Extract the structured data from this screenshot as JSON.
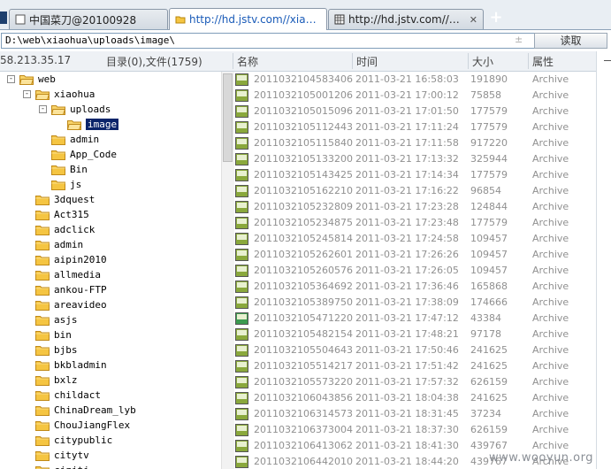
{
  "tabs": [
    {
      "label": "中国菜刀@20100928",
      "active": false
    },
    {
      "label": "http://hd.jstv.com//xiaohua/...",
      "active": true
    },
    {
      "label": "http://hd.jstv.com//xiaohua/...",
      "active": false
    }
  ],
  "new_tab_label": "+",
  "path_bar": {
    "path": "D:\\web\\xiaohua\\uploads\\image\\",
    "dropdown": "±",
    "read_button": "读取"
  },
  "header": {
    "ip": "58.213.35.17",
    "summary": "目录(0),文件(1759)",
    "col_name": "名称",
    "col_time": "时间",
    "col_size": "大小",
    "col_attr": "属性"
  },
  "tree": [
    {
      "label": "web",
      "level": 0,
      "expander": "-",
      "selected": false
    },
    {
      "label": "xiaohua",
      "level": 1,
      "expander": "-",
      "selected": false
    },
    {
      "label": "uploads",
      "level": 2,
      "expander": "-",
      "selected": false
    },
    {
      "label": "image",
      "level": 3,
      "expander": "",
      "selected": true
    },
    {
      "label": "admin",
      "level": 2,
      "expander": "",
      "selected": false
    },
    {
      "label": "App_Code",
      "level": 2,
      "expander": "",
      "selected": false
    },
    {
      "label": "Bin",
      "level": 2,
      "expander": "",
      "selected": false
    },
    {
      "label": "js",
      "level": 2,
      "expander": "",
      "selected": false
    },
    {
      "label": "3dquest",
      "level": 1,
      "expander": "",
      "selected": false
    },
    {
      "label": "Act315",
      "level": 1,
      "expander": "",
      "selected": false
    },
    {
      "label": "adclick",
      "level": 1,
      "expander": "",
      "selected": false
    },
    {
      "label": "admin",
      "level": 1,
      "expander": "",
      "selected": false
    },
    {
      "label": "aipin2010",
      "level": 1,
      "expander": "",
      "selected": false
    },
    {
      "label": "allmedia",
      "level": 1,
      "expander": "",
      "selected": false
    },
    {
      "label": "ankou-FTP",
      "level": 1,
      "expander": "",
      "selected": false
    },
    {
      "label": "areavideo",
      "level": 1,
      "expander": "",
      "selected": false
    },
    {
      "label": "asjs",
      "level": 1,
      "expander": "",
      "selected": false
    },
    {
      "label": "bin",
      "level": 1,
      "expander": "",
      "selected": false
    },
    {
      "label": "bjbs",
      "level": 1,
      "expander": "",
      "selected": false
    },
    {
      "label": "bkbladmin",
      "level": 1,
      "expander": "",
      "selected": false
    },
    {
      "label": "bxlz",
      "level": 1,
      "expander": "",
      "selected": false
    },
    {
      "label": "childact",
      "level": 1,
      "expander": "",
      "selected": false
    },
    {
      "label": "ChinaDream_lyb",
      "level": 1,
      "expander": "",
      "selected": false
    },
    {
      "label": "ChouJiangFlex",
      "level": 1,
      "expander": "",
      "selected": false
    },
    {
      "label": "citypublic",
      "level": 1,
      "expander": "",
      "selected": false
    },
    {
      "label": "citytv",
      "level": 1,
      "expander": "",
      "selected": false
    },
    {
      "label": "cjzjtj",
      "level": 1,
      "expander": "",
      "selected": false
    }
  ],
  "files": [
    {
      "name": "2011032104583406.j...",
      "time": "2011-03-21 16:58:03",
      "size": "191890",
      "attr": "Archive",
      "type": "JPG"
    },
    {
      "name": "20110321050012062...",
      "time": "2011-03-21 17:00:12",
      "size": "75858",
      "attr": "Archive",
      "type": "JPG"
    },
    {
      "name": "20110321050150968...",
      "time": "2011-03-21 17:01:50",
      "size": "177579",
      "attr": "Archive",
      "type": "JPG"
    },
    {
      "name": "20110321051124437...",
      "time": "2011-03-21 17:11:24",
      "size": "177579",
      "attr": "Archive",
      "type": "JPG"
    },
    {
      "name": "20110321051158406...",
      "time": "2011-03-21 17:11:58",
      "size": "917220",
      "attr": "Archive",
      "type": "JPG"
    },
    {
      "name": "20110321051332000...",
      "time": "2011-03-21 17:13:32",
      "size": "325944",
      "attr": "Archive",
      "type": "JPG"
    },
    {
      "name": "20110321051434250...",
      "time": "2011-03-21 17:14:34",
      "size": "177579",
      "attr": "Archive",
      "type": "JPG"
    },
    {
      "name": "20110321051622109...",
      "time": "2011-03-21 17:16:22",
      "size": "96854",
      "attr": "Archive",
      "type": "JPG"
    },
    {
      "name": "20110321052328093...",
      "time": "2011-03-21 17:23:28",
      "size": "124844",
      "attr": "Archive",
      "type": "JPG"
    },
    {
      "name": "20110321052348750...",
      "time": "2011-03-21 17:23:48",
      "size": "177579",
      "attr": "Archive",
      "type": "JPG"
    },
    {
      "name": "20110321052458140...",
      "time": "2011-03-21 17:24:58",
      "size": "109457",
      "attr": "Archive",
      "type": "JPG"
    },
    {
      "name": "20110321052626015...",
      "time": "2011-03-21 17:26:26",
      "size": "109457",
      "attr": "Archive",
      "type": "JPG"
    },
    {
      "name": "20110321052605765.j...",
      "time": "2011-03-21 17:26:05",
      "size": "109457",
      "attr": "Archive",
      "type": "JPG"
    },
    {
      "name": "20110321053646921...",
      "time": "2011-03-21 17:36:46",
      "size": "165868",
      "attr": "Archive",
      "type": "JPG"
    },
    {
      "name": "20110321053897501...",
      "time": "2011-03-21 17:38:09",
      "size": "174666",
      "attr": "Archive",
      "type": "JPG"
    },
    {
      "name": "20110321054712203...",
      "time": "2011-03-21 17:47:12",
      "size": "43384",
      "attr": "Archive",
      "type": "GIF"
    },
    {
      "name": "20110321054821546...",
      "time": "2011-03-21 17:48:21",
      "size": "97178",
      "attr": "Archive",
      "type": "JPG"
    },
    {
      "name": "20110321055046437...",
      "time": "2011-03-21 17:50:46",
      "size": "241625",
      "attr": "Archive",
      "type": "JPG"
    },
    {
      "name": "20110321055142171...",
      "time": "2011-03-21 17:51:42",
      "size": "241625",
      "attr": "Archive",
      "type": "JPG"
    },
    {
      "name": "20110321055732203...",
      "time": "2011-03-21 17:57:32",
      "size": "626159",
      "attr": "Archive",
      "type": "JPG"
    },
    {
      "name": "20110321060438562...",
      "time": "2011-03-21 18:04:38",
      "size": "241625",
      "attr": "Archive",
      "type": "JPG"
    },
    {
      "name": "20110321063145734...",
      "time": "2011-03-21 18:31:45",
      "size": "37234",
      "attr": "Archive",
      "type": "JPG"
    },
    {
      "name": "20110321063730046...",
      "time": "2011-03-21 18:37:30",
      "size": "626159",
      "attr": "Archive",
      "type": "JPG"
    },
    {
      "name": "20110321064130625...",
      "time": "2011-03-21 18:41:30",
      "size": "439767",
      "attr": "Archive",
      "type": "JPG"
    },
    {
      "name": "20110321064420109...",
      "time": "2011-03-21 18:44:20",
      "size": "439767",
      "attr": "Archive",
      "type": "JPG"
    }
  ],
  "watermark": "www.wooyun.org",
  "colors": {
    "accent": "#0a246a",
    "folder": "#f5c542",
    "jpg_icon": "#8aa83c",
    "gif_icon": "#3c9a50"
  }
}
